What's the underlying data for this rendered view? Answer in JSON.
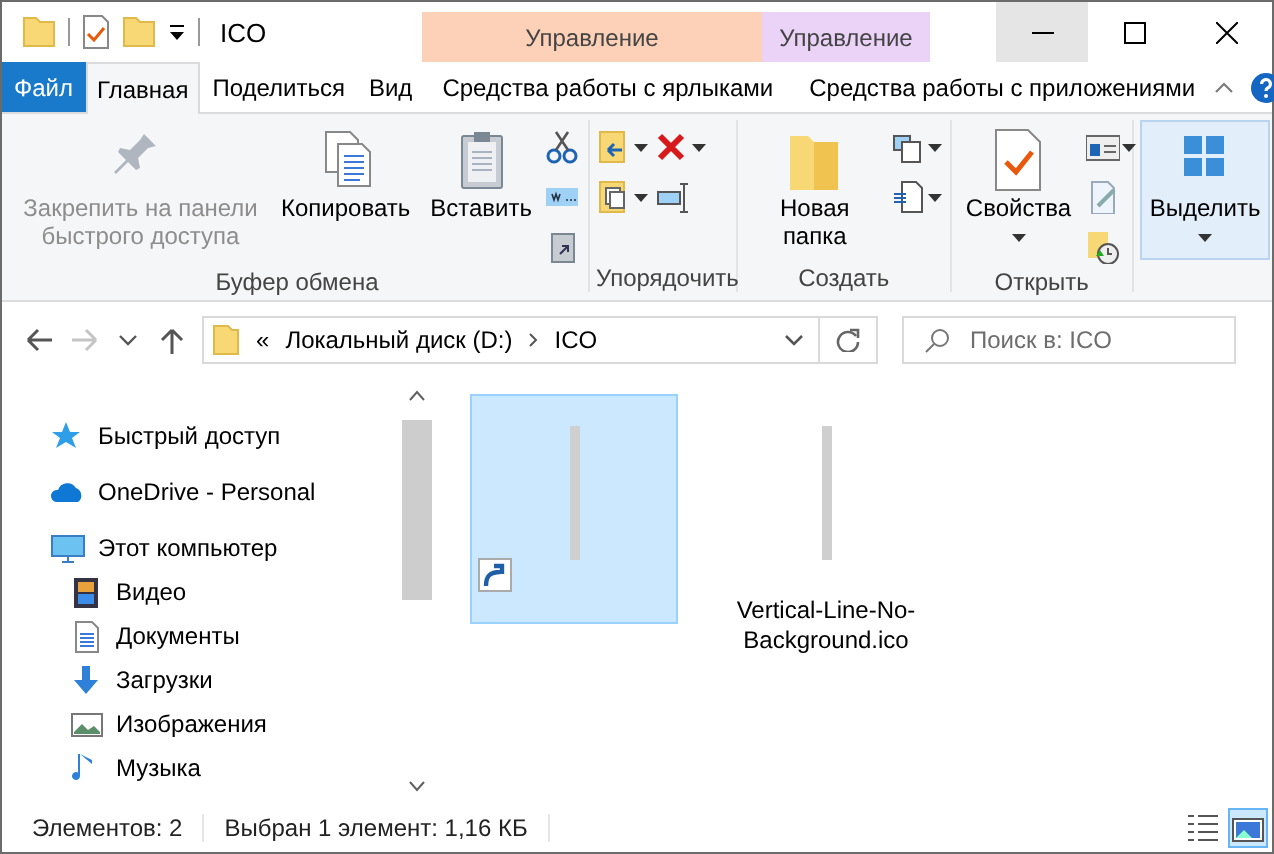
{
  "window": {
    "title": "ICO"
  },
  "context_headers": [
    {
      "label": "Управление",
      "color": "#fdd1b7"
    },
    {
      "label": "Управление",
      "color": "#ebd3f8"
    }
  ],
  "tabs": [
    {
      "label": "Файл",
      "kind": "file",
      "selected": false
    },
    {
      "label": "Главная",
      "kind": "plain",
      "selected": true
    },
    {
      "label": "Поделиться",
      "kind": "plain",
      "selected": false
    },
    {
      "label": "Вид",
      "kind": "plain",
      "selected": false
    },
    {
      "label": "Средства работы с ярлыками",
      "kind": "context",
      "selected": false
    },
    {
      "label": "Средства работы с приложениями",
      "kind": "context",
      "selected": false
    }
  ],
  "ribbon": {
    "groups": [
      {
        "label": "Буфер обмена",
        "buttons": [
          {
            "label": "Закрепить на панели быстрого доступа",
            "disabled": true,
            "dropdown": false,
            "highlighted": false
          },
          {
            "label": "Копировать",
            "disabled": false,
            "dropdown": false,
            "highlighted": false
          },
          {
            "label": "Вставить",
            "disabled": false,
            "dropdown": false,
            "highlighted": false
          }
        ]
      },
      {
        "label": "Упорядочить"
      },
      {
        "label": "Создать",
        "buttons": [
          {
            "label": "Новая папка",
            "disabled": false,
            "dropdown": false,
            "highlighted": false
          }
        ]
      },
      {
        "label": "Открыть",
        "buttons": [
          {
            "label": "Свойства",
            "disabled": false,
            "dropdown": true,
            "highlighted": false
          }
        ]
      },
      {
        "buttons": [
          {
            "label": "Выделить",
            "disabled": false,
            "dropdown": true,
            "highlighted": true
          }
        ]
      }
    ]
  },
  "nav_buttons": [
    {
      "kind": "back",
      "disabled": false
    },
    {
      "kind": "forward",
      "disabled": true
    },
    {
      "kind": "recent",
      "disabled": false
    },
    {
      "kind": "up",
      "disabled": false
    }
  ],
  "address": {
    "overflow": "«",
    "path": [
      "Локальный диск (D:)",
      "ICO"
    ]
  },
  "search": {
    "placeholder": "Поиск в: ICO"
  },
  "nav_pane": [
    {
      "label": "Быстрый доступ"
    },
    {
      "label": "OneDrive - Personal"
    },
    {
      "label": "Этот компьютер",
      "children": [
        {
          "label": "Видео"
        },
        {
          "label": "Документы"
        },
        {
          "label": "Загрузки"
        },
        {
          "label": "Изображения"
        },
        {
          "label": "Музыка"
        }
      ]
    }
  ],
  "files": [
    {
      "selected": true,
      "shortcut": true
    },
    {
      "name": "Vertical-Line-No-Background.ico",
      "selected": false,
      "shortcut": false
    }
  ],
  "status_bar": {
    "items": [
      "Элементов: 2",
      "Выбран 1 элемент: 1,16 КБ"
    ],
    "views": [
      {
        "kind": "details",
        "selected": false
      },
      {
        "kind": "large-icons",
        "selected": true
      }
    ]
  }
}
